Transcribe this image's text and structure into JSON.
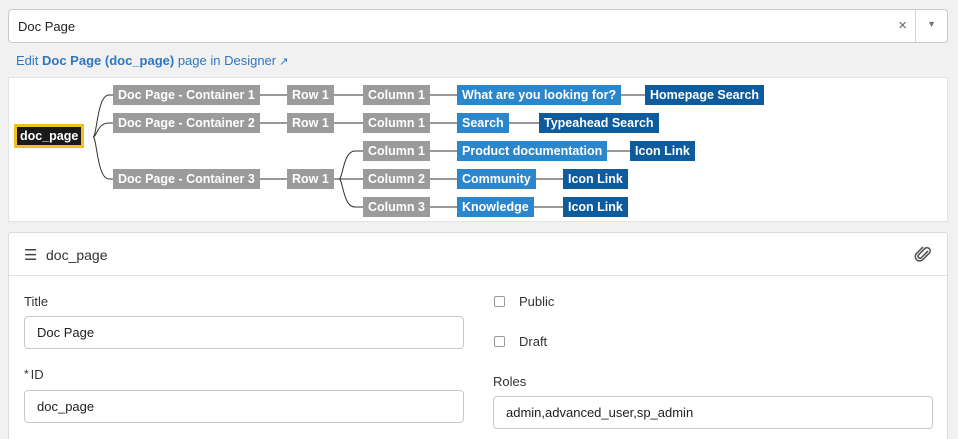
{
  "page_select": {
    "value": "Doc Page",
    "clear_icon": "×",
    "caret_icon": "▼"
  },
  "edit_link": {
    "prefix": "Edit ",
    "page_name": "Doc Page (doc_page)",
    "suffix": " page in Designer",
    "icon": "external-link-icon"
  },
  "tree": {
    "root": "doc_page",
    "containers": [
      "Doc Page - Container 1",
      "Doc Page - Container 2",
      "Doc Page - Container 3"
    ],
    "rows": [
      "Row 1",
      "Row 1",
      "Row 1"
    ],
    "columns": [
      "Column 1",
      "Column 1",
      "Column 1",
      "Column 2",
      "Column 3"
    ],
    "widget_instances": [
      "What are you looking for?",
      "Search",
      "Product documentation",
      "Community",
      "Knowledge"
    ],
    "widgets": [
      "Homepage Search",
      "Typeahead Search",
      "Icon Link",
      "Icon Link",
      "Icon Link"
    ],
    "colors": {
      "container": "#9b9b9b",
      "instance": "#2b86cc",
      "widget": "#0e5b9e",
      "root_border": "#f2c01e"
    }
  },
  "form": {
    "header_title": "doc_page",
    "title_label": "Title",
    "title_value": "Doc Page",
    "id_required_mark": "*",
    "id_label": "ID",
    "id_value": "doc_page",
    "public_label": "Public",
    "draft_label": "Draft",
    "roles_label": "Roles",
    "roles_value": "admin,advanced_user,sp_admin"
  }
}
